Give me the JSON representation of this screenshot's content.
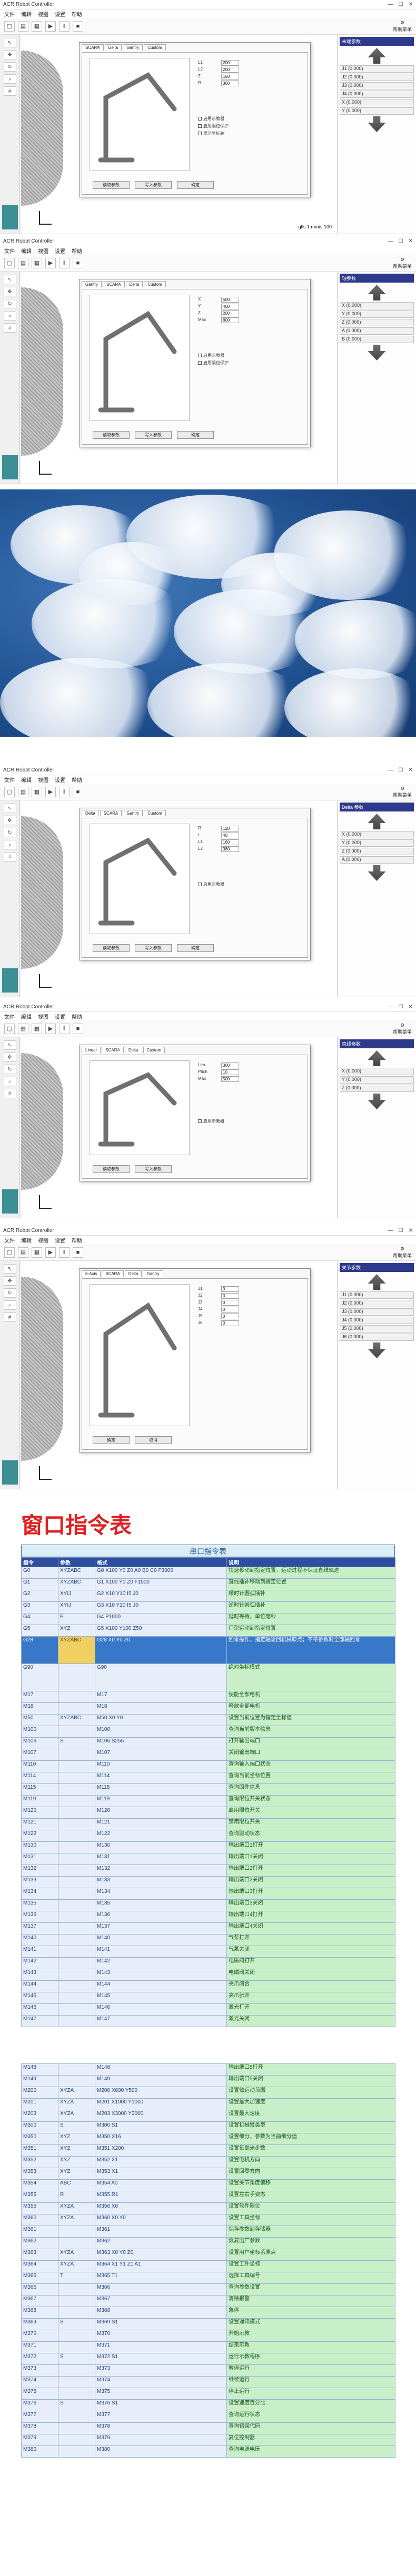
{
  "app": {
    "window_title": "ACR Robot Controller",
    "menus": [
      "文件",
      "编辑",
      "视图",
      "设置",
      "帮助"
    ],
    "help_label": "帮助菜单"
  },
  "screenshots": [
    {
      "id": "scara",
      "dialog_tabs": [
        "SCARA",
        "Delta",
        "Gantry",
        "Custom"
      ],
      "param_title": "末端参数",
      "params": [
        {
          "label": "L1",
          "value": "200"
        },
        {
          "label": "L2",
          "value": "200"
        },
        {
          "label": "Z",
          "value": "150"
        },
        {
          "label": "R",
          "value": "360"
        }
      ],
      "buttons": [
        "读取参数",
        "写入参数",
        "确定"
      ],
      "checks": [
        "启用示教器",
        "启用限位保护",
        "显示坐标轴"
      ],
      "right_rows": [
        "J1 (0.000)",
        "J2 (0.000)",
        "J3 (0.000)",
        "J4 (0.000)",
        "X (0.000)",
        "Y (0.000)"
      ],
      "footer": "gfls 1 mm/s 100"
    },
    {
      "id": "gantry",
      "dialog_tabs": [
        "Gantry",
        "SCARA",
        "Delta",
        "Custom"
      ],
      "param_title": "轴参数",
      "params": [
        {
          "label": "X",
          "value": "500"
        },
        {
          "label": "Y",
          "value": "400"
        },
        {
          "label": "Z",
          "value": "200"
        },
        {
          "label": "Max",
          "value": "800"
        }
      ],
      "buttons": [
        "读取参数",
        "写入参数",
        "确定"
      ],
      "checks": [
        "启用示教器",
        "启用限位保护"
      ],
      "right_rows": [
        "X (0.000)",
        "Y (0.000)",
        "Z (0.000)",
        "A (0.000)",
        "B (0.000)"
      ],
      "footer": ""
    },
    {
      "id": "delta",
      "dialog_tabs": [
        "Delta",
        "SCARA",
        "Gantry",
        "Custom"
      ],
      "param_title": "Delta 参数",
      "params": [
        {
          "label": "R",
          "value": "120"
        },
        {
          "label": "r",
          "value": "40"
        },
        {
          "label": "L1",
          "value": "160"
        },
        {
          "label": "L2",
          "value": "380"
        }
      ],
      "buttons": [
        "读取参数",
        "写入参数",
        "确定"
      ],
      "checks": [
        "启用示教器"
      ],
      "right_rows": [
        "X (0.000)",
        "Y (0.000)",
        "Z (0.000)",
        "A (0.000)"
      ],
      "footer": ""
    },
    {
      "id": "linear",
      "dialog_tabs": [
        "Linear",
        "SCARA",
        "Delta",
        "Custom"
      ],
      "param_title": "直线参数",
      "params": [
        {
          "label": "Len",
          "value": "300"
        },
        {
          "label": "Pitch",
          "value": "10"
        },
        {
          "label": "Max",
          "value": "500"
        }
      ],
      "buttons": [
        "读取参数",
        "写入参数"
      ],
      "checks": [
        "启用示教器"
      ],
      "right_rows": [
        "X (0.000)",
        "Y (0.000)",
        "Z (0.000)"
      ],
      "footer": ""
    },
    {
      "id": "sixaxis",
      "dialog_tabs": [
        "6-Axis",
        "SCARA",
        "Delta",
        "Gantry"
      ],
      "param_title": "关节参数",
      "params": [
        {
          "label": "J1",
          "value": "0"
        },
        {
          "label": "J2",
          "value": "0"
        },
        {
          "label": "J3",
          "value": "0"
        },
        {
          "label": "J4",
          "value": "0"
        },
        {
          "label": "J5",
          "value": "0"
        },
        {
          "label": "J6",
          "value": "0"
        }
      ],
      "buttons": [
        "确定",
        "取消"
      ],
      "checks": [],
      "right_rows": [
        "J1 (0.000)",
        "J2 (0.000)",
        "J3 (0.000)",
        "J4 (0.000)",
        "J5 (0.000)",
        "J6 (0.000)"
      ],
      "footer": ""
    }
  ],
  "table_section": {
    "heading": "窗口指令表",
    "table_title": "串口指令表",
    "columns": [
      "指令",
      "参数",
      "格式",
      "说明"
    ]
  },
  "commands": [
    {
      "cmd": "G0",
      "param": "XYZABC",
      "fmt": "G0 X100 Y0 Z0 A0 B0 C0 F3000",
      "desc": "快速移动到指定位置，运动过程不保证直线轨迹"
    },
    {
      "cmd": "G1",
      "param": "XYZABC",
      "fmt": "G1 X100 Y0 Z0 F1000",
      "desc": "直线插补移动到指定位置"
    },
    {
      "cmd": "G2",
      "param": "XYIJ",
      "fmt": "G2 X10 Y10 I5 J0",
      "desc": "顺时针圆弧插补"
    },
    {
      "cmd": "G3",
      "param": "XYIJ",
      "fmt": "G3 X10 Y10 I5 J0",
      "desc": "逆时针圆弧插补"
    },
    {
      "cmd": "G4",
      "param": "P",
      "fmt": "G4 P1000",
      "desc": "延时等待，单位毫秒"
    },
    {
      "cmd": "G5",
      "param": "XYZ",
      "fmt": "G5 X100 Y100 Z50",
      "desc": "门型运动到指定位置"
    },
    {
      "cmd": "G28",
      "param": "XYZABC",
      "fmt": "G28 X0 Y0 Z0",
      "desc": "回零操作，指定轴返回机械原点；不带参数时全部轴回零",
      "tall": true,
      "hl": true
    },
    {
      "cmd": "G90",
      "param": "",
      "fmt": "G90",
      "desc": "绝对坐标模式",
      "tall": true
    },
    {
      "cmd": "M17",
      "param": "",
      "fmt": "M17",
      "desc": "使能全部电机"
    },
    {
      "cmd": "M18",
      "param": "",
      "fmt": "M18",
      "desc": "释放全部电机"
    },
    {
      "cmd": "M50",
      "param": "XYZABC",
      "fmt": "M50 X0 Y0",
      "desc": "设置当前位置为指定坐标值"
    },
    {
      "cmd": "M100",
      "param": "",
      "fmt": "M100",
      "desc": "查询当前版本信息"
    },
    {
      "cmd": "M106",
      "param": "S",
      "fmt": "M106 S255",
      "desc": "打开输出端口"
    },
    {
      "cmd": "M107",
      "param": "",
      "fmt": "M107",
      "desc": "关闭输出端口"
    },
    {
      "cmd": "M110",
      "param": "",
      "fmt": "M110",
      "desc": "查询输入端口状态"
    },
    {
      "cmd": "M114",
      "param": "",
      "fmt": "M114",
      "desc": "查询当前坐标位置"
    },
    {
      "cmd": "M115",
      "param": "",
      "fmt": "M115",
      "desc": "查询固件信息"
    },
    {
      "cmd": "M119",
      "param": "",
      "fmt": "M119",
      "desc": "查询限位开关状态"
    },
    {
      "cmd": "M120",
      "param": "",
      "fmt": "M120",
      "desc": "启用限位开关"
    },
    {
      "cmd": "M121",
      "param": "",
      "fmt": "M121",
      "desc": "禁用限位开关"
    },
    {
      "cmd": "M122",
      "param": "",
      "fmt": "M122",
      "desc": "查询驱动状态"
    },
    {
      "cmd": "M130",
      "param": "",
      "fmt": "M130",
      "desc": "输出端口1打开"
    },
    {
      "cmd": "M131",
      "param": "",
      "fmt": "M131",
      "desc": "输出端口1关闭"
    },
    {
      "cmd": "M132",
      "param": "",
      "fmt": "M132",
      "desc": "输出端口2打开"
    },
    {
      "cmd": "M133",
      "param": "",
      "fmt": "M133",
      "desc": "输出端口2关闭"
    },
    {
      "cmd": "M134",
      "param": "",
      "fmt": "M134",
      "desc": "输出端口3打开"
    },
    {
      "cmd": "M135",
      "param": "",
      "fmt": "M135",
      "desc": "输出端口3关闭"
    },
    {
      "cmd": "M136",
      "param": "",
      "fmt": "M136",
      "desc": "输出端口4打开"
    },
    {
      "cmd": "M137",
      "param": "",
      "fmt": "M137",
      "desc": "输出端口4关闭"
    },
    {
      "cmd": "M140",
      "param": "",
      "fmt": "M140",
      "desc": "气泵打开"
    },
    {
      "cmd": "M141",
      "param": "",
      "fmt": "M141",
      "desc": "气泵关闭"
    },
    {
      "cmd": "M142",
      "param": "",
      "fmt": "M142",
      "desc": "电磁阀打开"
    },
    {
      "cmd": "M143",
      "param": "",
      "fmt": "M143",
      "desc": "电磁阀关闭"
    },
    {
      "cmd": "M144",
      "param": "",
      "fmt": "M144",
      "desc": "夹爪闭合"
    },
    {
      "cmd": "M145",
      "param": "",
      "fmt": "M145",
      "desc": "夹爪张开"
    },
    {
      "cmd": "M146",
      "param": "",
      "fmt": "M146",
      "desc": "激光打开"
    },
    {
      "cmd": "M147",
      "param": "",
      "fmt": "M147",
      "desc": "激光关闭"
    },
    {
      "cmd": "",
      "param": "",
      "fmt": "",
      "desc": "",
      "gap": true
    },
    {
      "cmd": "M148",
      "param": "",
      "fmt": "M148",
      "desc": "输出端口5打开"
    },
    {
      "cmd": "M149",
      "param": "",
      "fmt": "M149",
      "desc": "输出端口5关闭"
    },
    {
      "cmd": "M200",
      "param": "XYZA",
      "fmt": "M200 X600 Y500",
      "desc": "设置轴运动范围"
    },
    {
      "cmd": "M201",
      "param": "XYZA",
      "fmt": "M201 X1000 Y1000",
      "desc": "设置最大加速度"
    },
    {
      "cmd": "M203",
      "param": "XYZA",
      "fmt": "M203 X3000 Y3000",
      "desc": "设置最大速度"
    },
    {
      "cmd": "M300",
      "param": "S",
      "fmt": "M300 S1",
      "desc": "设置机械臂类型"
    },
    {
      "cmd": "M350",
      "param": "XYZ",
      "fmt": "M350 X16",
      "desc": "设置细分，参数为当前细分值"
    },
    {
      "cmd": "M351",
      "param": "XYZ",
      "fmt": "M351 X200",
      "desc": "设置每毫米步数"
    },
    {
      "cmd": "M352",
      "param": "XYZ",
      "fmt": "M352 X1",
      "desc": "设置电机方向"
    },
    {
      "cmd": "M353",
      "param": "XYZ",
      "fmt": "M353 X1",
      "desc": "设置回零方向"
    },
    {
      "cmd": "M354",
      "param": "ABC",
      "fmt": "M354 A0",
      "desc": "设置关节角度偏移"
    },
    {
      "cmd": "M355",
      "param": "R",
      "fmt": "M355 R1",
      "desc": "设置左右手姿态"
    },
    {
      "cmd": "M356",
      "param": "XYZA",
      "fmt": "M356 X0",
      "desc": "设置软件限位"
    },
    {
      "cmd": "M360",
      "param": "XYZA",
      "fmt": "M360 X0 Y0",
      "desc": "设置工具坐标"
    },
    {
      "cmd": "M361",
      "param": "",
      "fmt": "M361",
      "desc": "保存参数到存储器"
    },
    {
      "cmd": "M362",
      "param": "",
      "fmt": "M362",
      "desc": "恢复出厂参数"
    },
    {
      "cmd": "M363",
      "param": "XYZA",
      "fmt": "M363 X0 Y0 Z0",
      "desc": "设置用户坐标系原点"
    },
    {
      "cmd": "M364",
      "param": "XYZA",
      "fmt": "M364 X1 Y1 Z1 A1",
      "desc": "设置工件坐标"
    },
    {
      "cmd": "M365",
      "param": "T",
      "fmt": "M365 T1",
      "desc": "选择工具编号"
    },
    {
      "cmd": "M366",
      "param": "",
      "fmt": "M366",
      "desc": "查询参数设置"
    },
    {
      "cmd": "M367",
      "param": "",
      "fmt": "M367",
      "desc": "清除报警"
    },
    {
      "cmd": "M368",
      "param": "",
      "fmt": "M368",
      "desc": "急停"
    },
    {
      "cmd": "M369",
      "param": "S",
      "fmt": "M369 S1",
      "desc": "设置通讯模式"
    },
    {
      "cmd": "M370",
      "param": "",
      "fmt": "M370",
      "desc": "开始示教"
    },
    {
      "cmd": "M371",
      "param": "",
      "fmt": "M371",
      "desc": "结束示教"
    },
    {
      "cmd": "M372",
      "param": "S",
      "fmt": "M372 S1",
      "desc": "运行示教程序"
    },
    {
      "cmd": "M373",
      "param": "",
      "fmt": "M373",
      "desc": "暂停运行"
    },
    {
      "cmd": "M374",
      "param": "",
      "fmt": "M374",
      "desc": "继续运行"
    },
    {
      "cmd": "M375",
      "param": "",
      "fmt": "M375",
      "desc": "停止运行"
    },
    {
      "cmd": "M376",
      "param": "S",
      "fmt": "M376 S1",
      "desc": "设置速度百分比"
    },
    {
      "cmd": "M377",
      "param": "",
      "fmt": "M377",
      "desc": "查询运行状态"
    },
    {
      "cmd": "M378",
      "param": "",
      "fmt": "M378",
      "desc": "查询错误代码"
    },
    {
      "cmd": "M379",
      "param": "",
      "fmt": "M379",
      "desc": "复位控制器"
    },
    {
      "cmd": "M380",
      "param": "",
      "fmt": "M380",
      "desc": "查询电源电压"
    }
  ]
}
